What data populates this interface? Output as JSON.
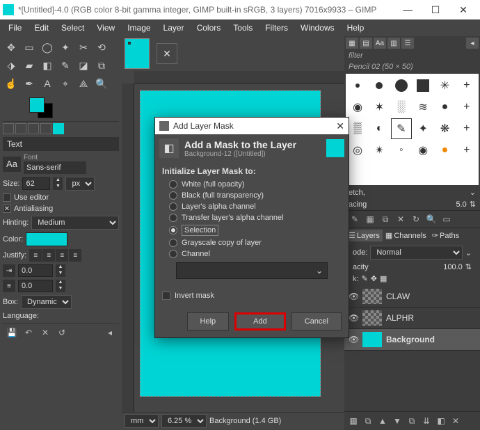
{
  "titlebar": {
    "title": "*[Untitled]-4.0 (RGB color 8-bit gamma integer, GIMP built-in sRGB, 3 layers) 7016x9933 – GIMP"
  },
  "menubar": [
    "File",
    "Edit",
    "Select",
    "View",
    "Image",
    "Layer",
    "Colors",
    "Tools",
    "Filters",
    "Windows",
    "Help"
  ],
  "tool_options": {
    "panel": "Text",
    "font_label": "Font",
    "font_value": "Sans-serif",
    "size_label": "Size:",
    "size_value": "62",
    "size_unit": "px",
    "use_editor": "Use editor",
    "antialiasing": "Antialiasing",
    "hinting_label": "Hinting:",
    "hinting_value": "Medium",
    "color_label": "Color:",
    "justify_label": "Justify:",
    "indent_value": "0.0",
    "line_value": "0.0",
    "box_label": "Box:",
    "box_value": "Dynamic",
    "language_label": "Language:"
  },
  "statusbar": {
    "unit": "mm",
    "zoom": "6.25 %",
    "layer": "Background (1.4 GB)"
  },
  "right": {
    "filter": "filter",
    "brush": "Pencil 02 (50 × 50)",
    "stretch_label": "etch,",
    "spacing_label": "acing",
    "spacing_value": "5.0",
    "tabs": {
      "layers": "Layers",
      "channels": "Channels",
      "paths": "Paths"
    },
    "mode_label": "ode:",
    "mode_value": "Normal",
    "opacity_label": "acity",
    "opacity_value": "100.0",
    "lock_label": "k:",
    "layers": [
      {
        "name": "CLAW"
      },
      {
        "name": "ALPHR"
      },
      {
        "name": "Background"
      }
    ]
  },
  "dialog": {
    "title": "Add Layer Mask",
    "heading": "Add a Mask to the Layer",
    "sub": "Background-12 ([Untitled])",
    "section": "Initialize Layer Mask to:",
    "options": [
      "White (full opacity)",
      "Black (full transparency)",
      "Layer's alpha channel",
      "Transfer layer's alpha channel",
      "Selection",
      "Grayscale copy of layer",
      "Channel"
    ],
    "invert": "Invert mask",
    "help": "Help",
    "add": "Add",
    "cancel": "Cancel"
  }
}
